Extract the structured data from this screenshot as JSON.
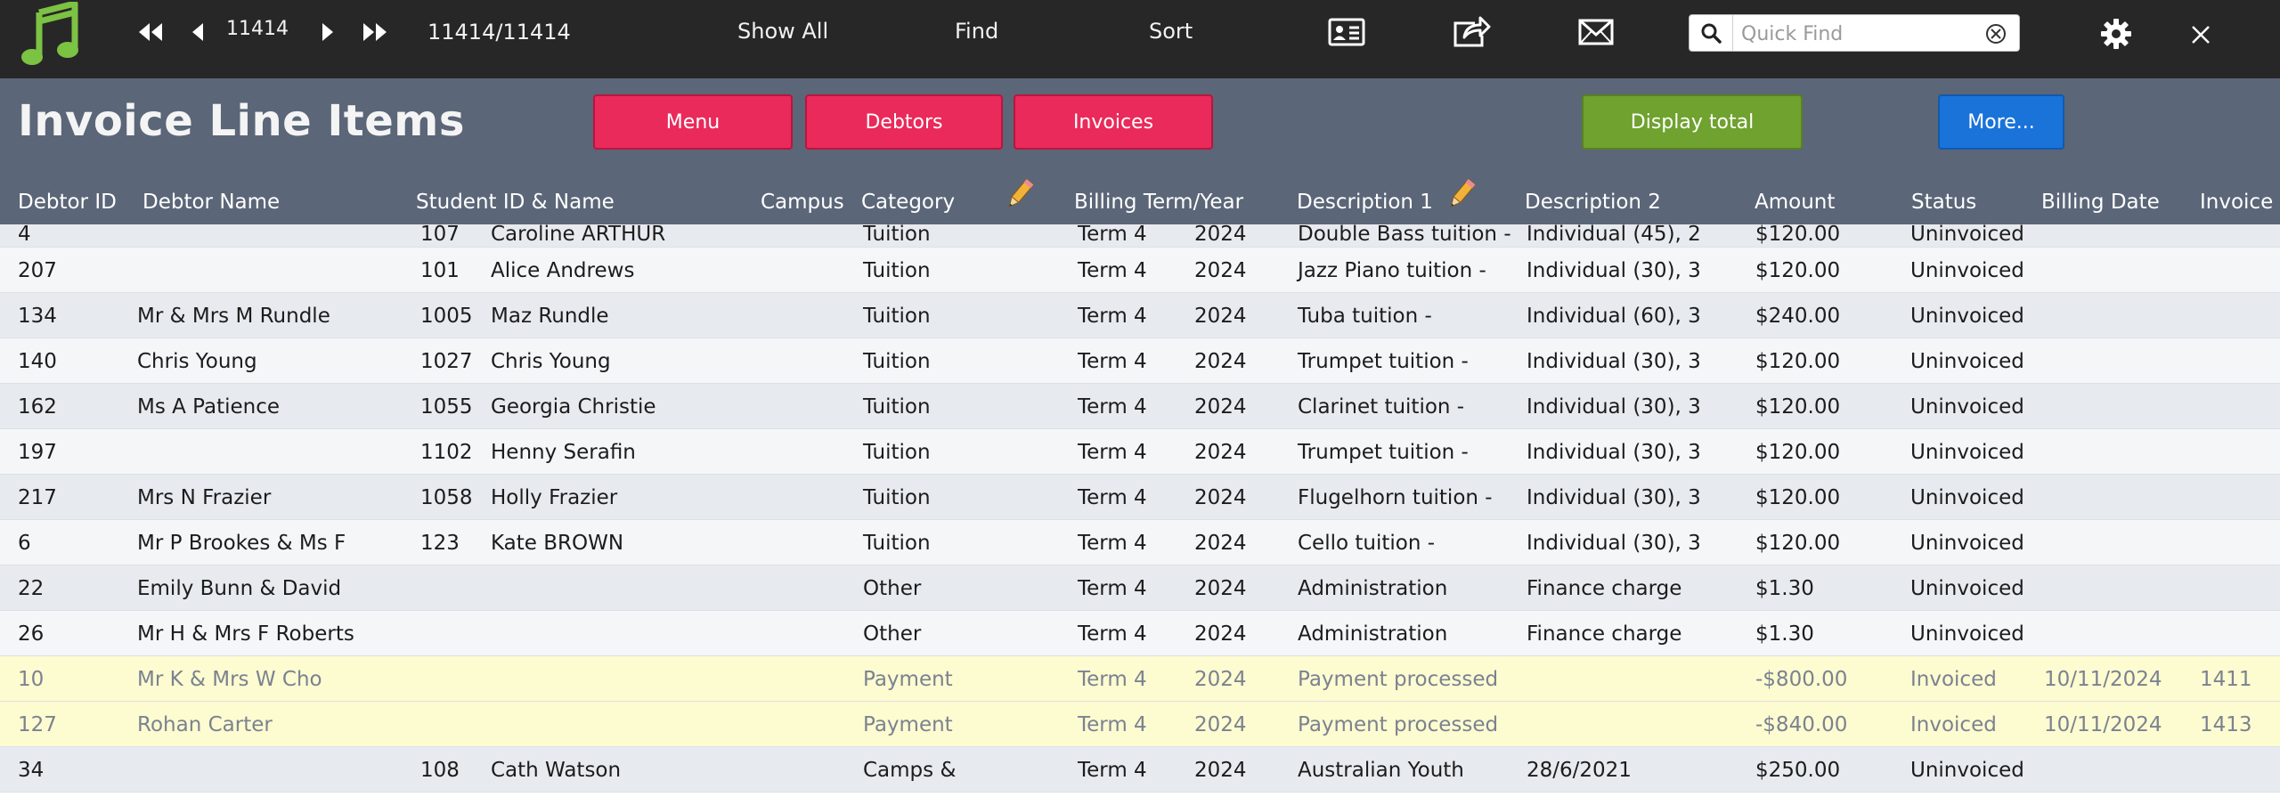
{
  "toolbar": {
    "record_number": "11414",
    "record_count": "11414/11414",
    "show_all": "Show All",
    "find": "Find",
    "sort": "Sort",
    "quick_find_placeholder": "Quick Find"
  },
  "header": {
    "title": "Invoice Line Items",
    "buttons": {
      "menu": "Menu",
      "debtors": "Debtors",
      "invoices": "Invoices",
      "display_total": "Display total",
      "more": "More..."
    }
  },
  "columns": {
    "debtor_id": "Debtor ID",
    "debtor_name": "Debtor Name",
    "student": "Student ID & Name",
    "campus": "Campus",
    "category": "Category",
    "billing_term": "Billing Term/Year",
    "description1": "Description 1",
    "description2": "Description 2",
    "amount": "Amount",
    "status": "Status",
    "billing_date": "Billing Date",
    "invoice": "Invoice"
  },
  "colors": {
    "toolbar_bg": "#272727",
    "header_bg": "#5b6678",
    "pink_button": "#ea2a5a",
    "green_button": "#6fa22e",
    "blue_button": "#1a73d9",
    "logo_green": "#7cc243",
    "payment_row": "#fdfbd0"
  },
  "icons": {
    "logo": "music-note-icon",
    "first": "first-record-icon",
    "prev": "previous-record-icon",
    "next": "next-record-icon",
    "last": "last-record-icon",
    "card": "contact-card-icon",
    "share": "share-export-icon",
    "mail": "envelope-icon",
    "search": "search-icon",
    "clear": "clear-icon",
    "settings": "gear-icon",
    "close": "close-icon",
    "edit": "pencil-icon"
  },
  "rows": [
    {
      "debtor_id": "4",
      "debtor_name": "",
      "student_id": "107",
      "student_name": "Caroline ARTHUR",
      "campus": "",
      "category": "Tuition",
      "term": "Term 4",
      "year": "2024",
      "desc1": "Double Bass tuition -",
      "desc2": "Individual (45), 2",
      "amount": "$120.00",
      "status": "Uninvoiced",
      "billing_date": "",
      "invoice": "",
      "kind": "alt"
    },
    {
      "debtor_id": "207",
      "debtor_name": "",
      "student_id": "101",
      "student_name": "Alice Andrews",
      "campus": "",
      "category": "Tuition",
      "term": "Term 4",
      "year": "2024",
      "desc1": "Jazz Piano tuition -",
      "desc2": "Individual (30), 3",
      "amount": "$120.00",
      "status": "Uninvoiced",
      "billing_date": "",
      "invoice": "",
      "kind": "plain"
    },
    {
      "debtor_id": "134",
      "debtor_name": "Mr & Mrs M Rundle",
      "student_id": "1005",
      "student_name": "Maz Rundle",
      "campus": "",
      "category": "Tuition",
      "term": "Term 4",
      "year": "2024",
      "desc1": "Tuba tuition -",
      "desc2": "Individual (60), 3",
      "amount": "$240.00",
      "status": "Uninvoiced",
      "billing_date": "",
      "invoice": "",
      "kind": "alt"
    },
    {
      "debtor_id": "140",
      "debtor_name": "Chris  Young",
      "student_id": "1027",
      "student_name": "Chris  Young",
      "campus": "",
      "category": "Tuition",
      "term": "Term 4",
      "year": "2024",
      "desc1": "Trumpet tuition -",
      "desc2": "Individual (30), 3",
      "amount": "$120.00",
      "status": "Uninvoiced",
      "billing_date": "",
      "invoice": "",
      "kind": "plain"
    },
    {
      "debtor_id": "162",
      "debtor_name": "Ms A Patience",
      "student_id": "1055",
      "student_name": "Georgia Christie",
      "campus": "",
      "category": "Tuition",
      "term": "Term 4",
      "year": "2024",
      "desc1": "Clarinet tuition -",
      "desc2": "Individual (30), 3",
      "amount": "$120.00",
      "status": "Uninvoiced",
      "billing_date": "",
      "invoice": "",
      "kind": "alt"
    },
    {
      "debtor_id": "197",
      "debtor_name": "",
      "student_id": "1102",
      "student_name": "Henny Serafin",
      "campus": "",
      "category": "Tuition",
      "term": "Term 4",
      "year": "2024",
      "desc1": "Trumpet tuition -",
      "desc2": "Individual (30), 3",
      "amount": "$120.00",
      "status": "Uninvoiced",
      "billing_date": "",
      "invoice": "",
      "kind": "plain"
    },
    {
      "debtor_id": "217",
      "debtor_name": "Mrs N Frazier",
      "student_id": "1058",
      "student_name": "Holly Frazier",
      "campus": "",
      "category": "Tuition",
      "term": "Term 4",
      "year": "2024",
      "desc1": "Flugelhorn tuition -",
      "desc2": "Individual (30), 3",
      "amount": "$120.00",
      "status": "Uninvoiced",
      "billing_date": "",
      "invoice": "",
      "kind": "alt"
    },
    {
      "debtor_id": "6",
      "debtor_name": "Mr P Brookes & Ms F",
      "student_id": "123",
      "student_name": "Kate BROWN",
      "campus": "",
      "category": "Tuition",
      "term": "Term 4",
      "year": "2024",
      "desc1": "Cello tuition -",
      "desc2": "Individual (30), 3",
      "amount": "$120.00",
      "status": "Uninvoiced",
      "billing_date": "",
      "invoice": "",
      "kind": "plain"
    },
    {
      "debtor_id": "22",
      "debtor_name": "Emily Bunn & David",
      "student_id": "",
      "student_name": "",
      "campus": "",
      "category": "Other",
      "term": "Term 4",
      "year": "2024",
      "desc1": "Administration",
      "desc2": "Finance charge",
      "amount": "$1.30",
      "status": "Uninvoiced",
      "billing_date": "",
      "invoice": "",
      "kind": "alt"
    },
    {
      "debtor_id": "26",
      "debtor_name": "Mr H & Mrs F Roberts",
      "student_id": "",
      "student_name": "",
      "campus": "",
      "category": "Other",
      "term": "Term 4",
      "year": "2024",
      "desc1": "Administration",
      "desc2": "Finance charge",
      "amount": "$1.30",
      "status": "Uninvoiced",
      "billing_date": "",
      "invoice": "",
      "kind": "plain"
    },
    {
      "debtor_id": "10",
      "debtor_name": "Mr K & Mrs W Cho",
      "student_id": "",
      "student_name": "",
      "campus": "",
      "category": "Payment",
      "term": "Term 4",
      "year": "2024",
      "desc1": "Payment processed",
      "desc2": "",
      "amount": "-$800.00",
      "status": "Invoiced",
      "billing_date": "10/11/2024",
      "invoice": "1411",
      "kind": "payment"
    },
    {
      "debtor_id": "127",
      "debtor_name": "Rohan Carter",
      "student_id": "",
      "student_name": "",
      "campus": "",
      "category": "Payment",
      "term": "Term 4",
      "year": "2024",
      "desc1": "Payment processed",
      "desc2": "",
      "amount": "-$840.00",
      "status": "Invoiced",
      "billing_date": "10/11/2024",
      "invoice": "1413",
      "kind": "payment"
    },
    {
      "debtor_id": "34",
      "debtor_name": "",
      "student_id": "108",
      "student_name": "Cath Watson",
      "campus": "",
      "category": "Camps &",
      "term": "Term 4",
      "year": "2024",
      "desc1": "Australian Youth",
      "desc2": "28/6/2021",
      "amount": "$250.00",
      "status": "Uninvoiced",
      "billing_date": "",
      "invoice": "",
      "kind": "alt"
    }
  ]
}
